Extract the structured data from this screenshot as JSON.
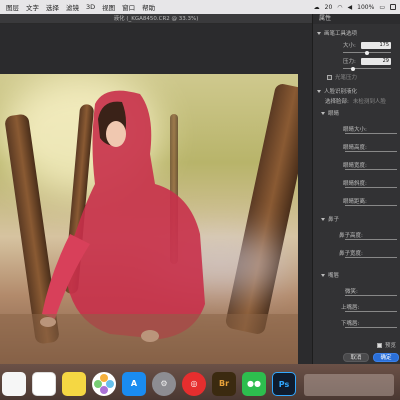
{
  "menubar": {
    "items": [
      "图层",
      "文字",
      "选择",
      "滤镜",
      "3D",
      "视图",
      "窗口",
      "帮助"
    ],
    "status": [
      "20",
      "100%"
    ]
  },
  "document": {
    "title": "液化 (_KGA8450.CR2 @ 33.3%)"
  },
  "panel": {
    "title": "属性",
    "section_brush": "画笔工具选项",
    "size_label": "大小:",
    "size_value": "175",
    "pressure_label": "压力:",
    "pressure_value": "29",
    "stylus_label": "光笔压力",
    "face_section": "人脸识别液化",
    "select_face_label": "选择脸部:",
    "select_face_value": "未检测到人脸",
    "eyes_label": "眼睛",
    "eye_rows": [
      "眼睛大小:",
      "眼睛高度:",
      "眼睛宽度:",
      "眼睛斜度:",
      "眼睛距离:"
    ],
    "nose_label": "鼻子",
    "nose_rows": [
      "鼻子高度:",
      "鼻子宽度:"
    ],
    "mouth_label": "嘴唇",
    "mouth_rows": [
      "微笑:",
      "上嘴唇:",
      "下嘴唇:"
    ],
    "preview_label": "预览",
    "cancel": "取消",
    "ok": "确定"
  },
  "dock": {
    "icons": [
      {
        "name": "notes-icon",
        "color": "#f6f6f6"
      },
      {
        "name": "reminders-icon",
        "color": "#ffffff"
      },
      {
        "name": "stickies-icon",
        "color": "#f5d743"
      },
      {
        "name": "photos-icon",
        "color": "#ffffff"
      },
      {
        "name": "app-store-icon",
        "color": "#1a8cf0"
      },
      {
        "name": "system-preferences-icon",
        "color": "#8d8d92"
      },
      {
        "name": "netease-music-icon",
        "color": "#e62e2e"
      },
      {
        "name": "bridge-icon",
        "color": "#3b2a10"
      },
      {
        "name": "wechat-icon",
        "color": "#2dbe4e"
      },
      {
        "name": "photoshop-icon",
        "color": "#0f1c2e"
      }
    ],
    "bridge_text": "Br",
    "photoshop_text": "Ps"
  }
}
